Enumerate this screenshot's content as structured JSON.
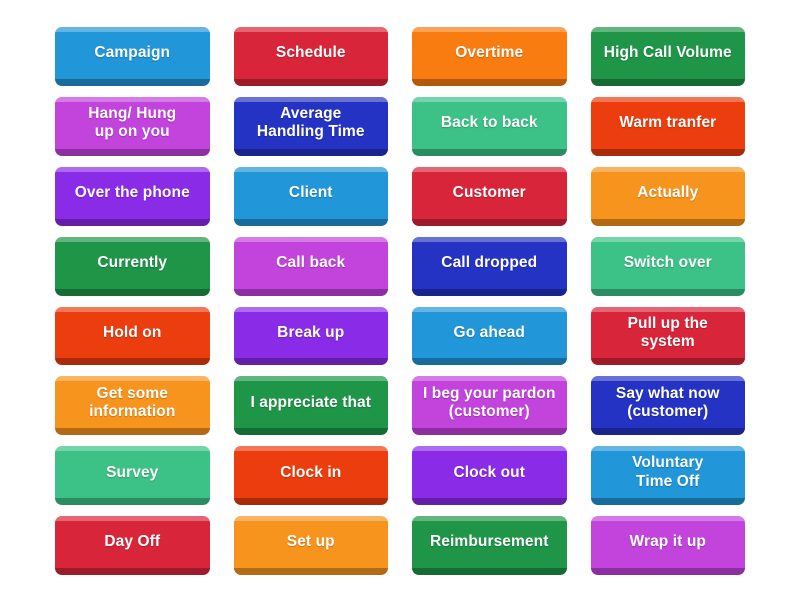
{
  "app": {
    "title": "Match Up Tiles",
    "background_color": "#ffffff",
    "grid_columns": 4,
    "grid_rows": 8,
    "tile_count": 32
  },
  "palette": {
    "sky_blue": "#2196d8",
    "crimson": "#d92539",
    "orange": "#f87c10",
    "forest_green": "#1f9548",
    "orchid": "#c343dd",
    "navy_blue": "#2533c4",
    "mint_green": "#3cc287",
    "red_orange": "#eb3d0e",
    "violet": "#8a2be8",
    "amber": "#f7941e"
  },
  "tiles": [
    {
      "label": "Campaign",
      "color": "#2196d8"
    },
    {
      "label": "Schedule",
      "color": "#d92539"
    },
    {
      "label": "Overtime",
      "color": "#f87c10"
    },
    {
      "label": "High Call Volume",
      "color": "#1f9548"
    },
    {
      "label": "Hang/ Hung\nup on you",
      "color": "#c343dd"
    },
    {
      "label": "Average\nHandling Time",
      "color": "#2533c4"
    },
    {
      "label": "Back to back",
      "color": "#3cc287"
    },
    {
      "label": "Warm tranfer",
      "color": "#eb3d0e"
    },
    {
      "label": "Over the phone",
      "color": "#8a2be8"
    },
    {
      "label": "Client",
      "color": "#2196d8"
    },
    {
      "label": "Customer",
      "color": "#d92539"
    },
    {
      "label": "Actually",
      "color": "#f7941e"
    },
    {
      "label": "Currently",
      "color": "#1f9548"
    },
    {
      "label": "Call back",
      "color": "#c343dd"
    },
    {
      "label": "Call dropped",
      "color": "#2533c4"
    },
    {
      "label": "Switch over",
      "color": "#3cc287"
    },
    {
      "label": "Hold on",
      "color": "#eb3d0e"
    },
    {
      "label": "Break up",
      "color": "#8a2be8"
    },
    {
      "label": "Go ahead",
      "color": "#2196d8"
    },
    {
      "label": "Pull up the\nsystem",
      "color": "#d92539"
    },
    {
      "label": "Get some\ninformation",
      "color": "#f7941e"
    },
    {
      "label": "I appreciate that",
      "color": "#1f9548"
    },
    {
      "label": "I beg your pardon\n(customer)",
      "color": "#c343dd"
    },
    {
      "label": "Say what now\n(customer)",
      "color": "#2533c4"
    },
    {
      "label": "Survey",
      "color": "#3cc287"
    },
    {
      "label": "Clock in",
      "color": "#eb3d0e"
    },
    {
      "label": "Clock out",
      "color": "#8a2be8"
    },
    {
      "label": "Voluntary\nTime Off",
      "color": "#2196d8"
    },
    {
      "label": "Day Off",
      "color": "#d92539"
    },
    {
      "label": "Set up",
      "color": "#f7941e"
    },
    {
      "label": "Reimbursement",
      "color": "#1f9548"
    },
    {
      "label": "Wrap it up",
      "color": "#c343dd"
    }
  ]
}
